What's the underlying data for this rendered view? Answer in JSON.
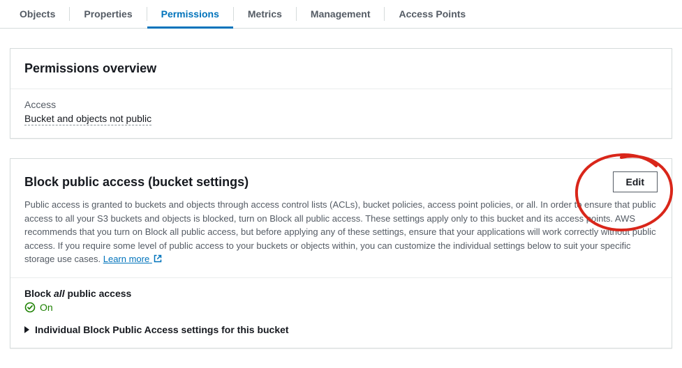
{
  "tabs": {
    "objects": "Objects",
    "properties": "Properties",
    "permissions": "Permissions",
    "metrics": "Metrics",
    "management": "Management",
    "access_points": "Access Points"
  },
  "overview": {
    "title": "Permissions overview",
    "access_label": "Access",
    "access_value": "Bucket and objects not public"
  },
  "bpa": {
    "title": "Block public access (bucket settings)",
    "edit_label": "Edit",
    "description": "Public access is granted to buckets and objects through access control lists (ACLs), bucket policies, access point policies, or all. In order to ensure that public access to all your S3 buckets and objects is blocked, turn on Block all public access. These settings apply only to this bucket and its access points. AWS recommends that you turn on Block all public access, but before applying any of these settings, ensure that your applications will work correctly without public access. If you require some level of public access to your buckets or objects within, you can customize the individual settings below to suit your specific storage use cases. ",
    "learn_more": "Learn more",
    "block_all_prefix": "Block ",
    "block_all_em": "all",
    "block_all_suffix": " public access",
    "status": "On",
    "expander": "Individual Block Public Access settings for this bucket"
  }
}
